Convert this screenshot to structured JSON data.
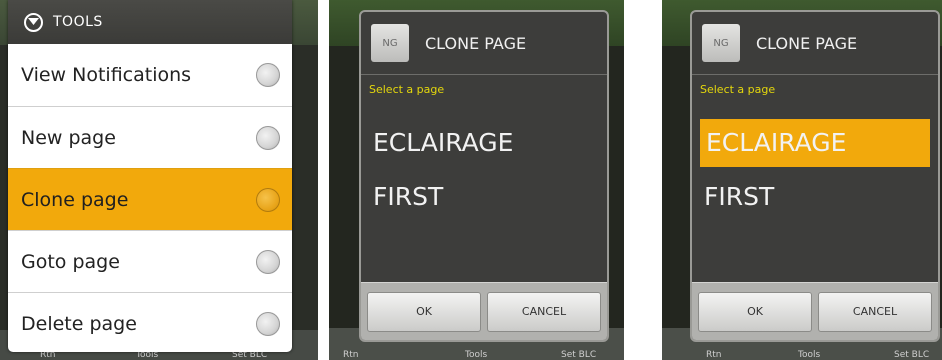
{
  "menu": {
    "title": "TOOLS",
    "items": [
      {
        "label": "View Notifications"
      },
      {
        "label": "New page"
      },
      {
        "label": "Clone page"
      },
      {
        "label": "Goto page"
      },
      {
        "label": "Delete page"
      }
    ],
    "selected_item": "Clone page",
    "bottom_labels": [
      "Rtn",
      "Tools",
      "Set BLC"
    ]
  },
  "dialog_before": {
    "thumb_label": "NG",
    "title": "CLONE PAGE",
    "subhead": "Select a page",
    "options": [
      "ECLAIRAGE",
      "FIRST"
    ],
    "ok_label": "OK",
    "cancel_label": "CANCEL",
    "bottom_labels": [
      "Rtn",
      "Tools",
      "Set BLC"
    ]
  },
  "dialog_after": {
    "thumb_label": "NG",
    "title": "CLONE PAGE",
    "subhead": "Select a page",
    "options": [
      "ECLAIRAGE",
      "FIRST"
    ],
    "selected_option": "ECLAIRAGE",
    "ok_label": "OK",
    "cancel_label": "CANCEL",
    "bottom_labels": [
      "Rtn",
      "Tools",
      "Set BLC"
    ]
  },
  "colors": {
    "highlight": "#f2a90c",
    "subhead": "#e4d70c",
    "dialog_bg": "#3d3d3b"
  }
}
